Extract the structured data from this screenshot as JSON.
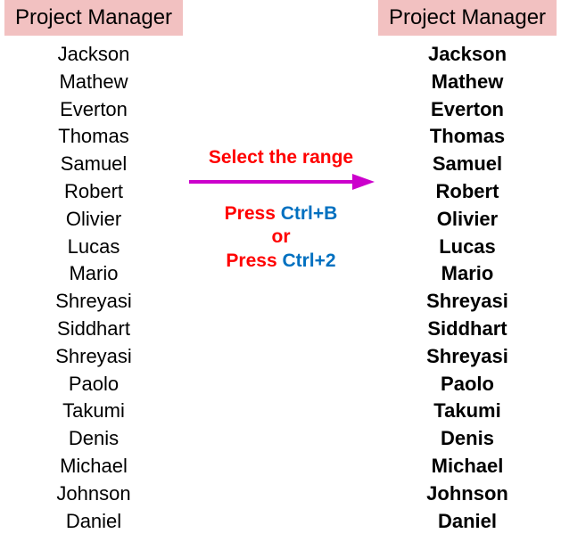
{
  "header": "Project Manager",
  "names": [
    "Jackson",
    "Mathew",
    "Everton",
    "Thomas",
    "Samuel",
    "Robert",
    "Olivier",
    "Lucas",
    "Mario",
    "Shreyasi",
    "Siddhart",
    "Shreyasi",
    "Paolo",
    "Takumi",
    "Denis",
    "Michael",
    "Johnson",
    "Daniel"
  ],
  "instruction": {
    "select": "Select the range",
    "press_word": "Press ",
    "ctrl_b": "Ctrl+B",
    "or": "or",
    "ctrl_2": "Ctrl+2"
  },
  "colors": {
    "header_bg": "#F2C1C1",
    "red": "#FF0000",
    "blue": "#0070C0",
    "arrow": "#CC00CC"
  }
}
